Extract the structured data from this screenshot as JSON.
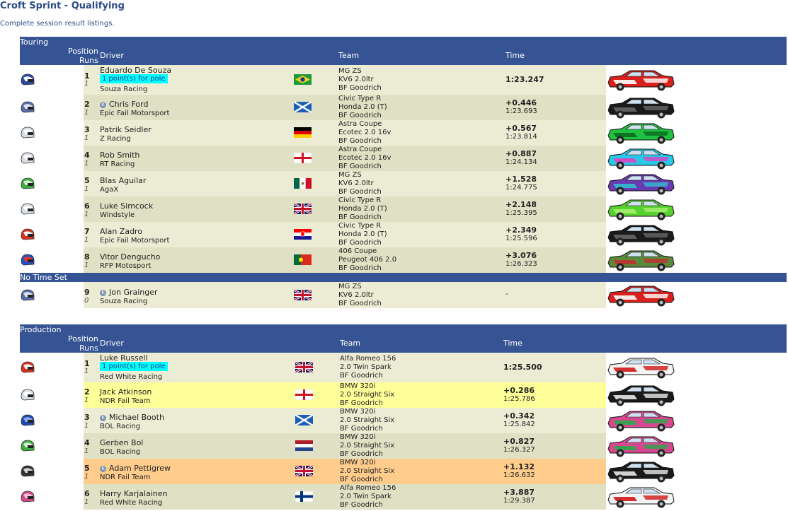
{
  "page": {
    "title": "Croft Sprint - Qualifying",
    "subtitle": "Complete session result listings."
  },
  "headers": {
    "position": "Position",
    "runs": "Runs",
    "driver": "Driver",
    "team": "Team",
    "time": "Time"
  },
  "touring": {
    "class_name": "Touring",
    "no_time_label": "No Time Set",
    "rows": [
      {
        "pos": "1",
        "runs": "1",
        "driver": "Eduardo De Souza",
        "badge": "1 point(s) for pole",
        "team": "Souza Racing",
        "car": [
          "MG ZS",
          "KV6 2.0ltr",
          "BF Goodrich"
        ],
        "time": "1:23.247",
        "lap": "",
        "flag": "brazil",
        "helmet": "helmet-blue-white",
        "livery": "red-white"
      },
      {
        "pos": "2",
        "runs": "1",
        "driver": "Chris Ford",
        "k": true,
        "team": "Epic Fail Motorsport",
        "car": [
          "Civic Type R",
          "Honda 2.0 (T)",
          "BF Goodrich"
        ],
        "time": "+0.446",
        "lap": "1:23.693",
        "flag": "scotland",
        "helmet": "helmet-blue-silver",
        "livery": "black"
      },
      {
        "pos": "3",
        "runs": "1",
        "driver": "Patrik Seidler",
        "team": "Z Racing",
        "car": [
          "Astra Coupe",
          "Ecotec 2.0 16v",
          "BF Goodrich"
        ],
        "time": "+0.567",
        "lap": "1:23.814",
        "flag": "germany",
        "helmet": "helmet-white",
        "livery": "green"
      },
      {
        "pos": "4",
        "runs": "1",
        "driver": "Rob Smith",
        "team": "RT Racing",
        "car": [
          "Astra Coupe",
          "Ecotec 2.0 16v",
          "BF Goodrich"
        ],
        "time": "+0.887",
        "lap": "1:24.134",
        "flag": "england",
        "helmet": "helmet-white",
        "livery": "cyan-pink"
      },
      {
        "pos": "5",
        "runs": "1",
        "driver": "Blas Aguilar",
        "team": "AgaX",
        "car": [
          "MG ZS",
          "KV6 2.0ltr",
          "BF Goodrich"
        ],
        "time": "+1.528",
        "lap": "1:24.775",
        "flag": "mexico",
        "helmet": "helmet-green",
        "livery": "purple"
      },
      {
        "pos": "6",
        "runs": "1",
        "driver": "Luke Simcock",
        "team": "Windstyle",
        "car": [
          "Civic Type R",
          "Honda 2.0 (T)",
          "BF Goodrich"
        ],
        "time": "+2.148",
        "lap": "1:25.395",
        "flag": "uk",
        "helmet": "helmet-white",
        "livery": "lime"
      },
      {
        "pos": "7",
        "runs": "1",
        "driver": "Alan Zadro",
        "team": "Epic Fail Motorsport",
        "car": [
          "Civic Type R",
          "Honda 2.0 (T)",
          "BF Goodrich"
        ],
        "time": "+2.349",
        "lap": "1:25.596",
        "flag": "croatia",
        "helmet": "helmet-red-white",
        "livery": "black"
      },
      {
        "pos": "8",
        "runs": "1",
        "driver": "Vitor Dengucho",
        "team": "RFP Motosport",
        "car": [
          "406 Coupe",
          "Peugeot 406 2.0",
          "BF Goodrich"
        ],
        "time": "+3.076",
        "lap": "1:26.323",
        "flag": "portugal",
        "helmet": "helmet-blue-red",
        "livery": "olive"
      }
    ],
    "no_time_rows": [
      {
        "pos": "9",
        "runs": "0",
        "driver": "Jon Grainger",
        "k": true,
        "team": "Souza Racing",
        "car": [
          "MG ZS",
          "KV6 2.0ltr",
          "BF Goodrich"
        ],
        "time": "-",
        "lap": "",
        "flag": "uk",
        "helmet": "helmet-blue-silver",
        "livery": "red-white"
      }
    ]
  },
  "production": {
    "class_name": "Production",
    "rows": [
      {
        "pos": "1",
        "runs": "1",
        "driver": "Luke Russell",
        "badge": "1 point(s) for pole",
        "team": "Red White Racing",
        "car": [
          "Alfa Romeo 156",
          "2.0 Twin Spark",
          "BF Goodrich"
        ],
        "time": "1:25.500",
        "lap": "",
        "flag": "uk",
        "helmet": "helmet-red-white",
        "livery": "white-red"
      },
      {
        "pos": "2",
        "runs": "1",
        "driver": "Jack Atkinson",
        "team": "NDR Fail Team",
        "car": [
          "BMW 320i",
          "2.0 Straight Six",
          "BF Goodrich"
        ],
        "time": "+0.286",
        "lap": "1:25.786",
        "flag": "england",
        "helmet": "helmet-white",
        "livery": "black-coke",
        "hl": "yellow"
      },
      {
        "pos": "3",
        "runs": "1",
        "driver": "Michael Booth",
        "k": true,
        "team": "BOL Racing",
        "car": [
          "BMW 320i",
          "2.0 Straight Six",
          "BF Goodrich"
        ],
        "time": "+0.342",
        "lap": "1:25.842",
        "flag": "scotland",
        "helmet": "helmet-blue",
        "livery": "pink-green"
      },
      {
        "pos": "4",
        "runs": "1",
        "driver": "Gerben Bol",
        "team": "BOL Racing",
        "car": [
          "BMW 320i",
          "2.0 Straight Six",
          "BF Goodrich"
        ],
        "time": "+0.827",
        "lap": "1:26.327",
        "flag": "netherlands",
        "helmet": "helmet-green",
        "livery": "pink-green"
      },
      {
        "pos": "5",
        "runs": "1",
        "driver": "Adam Pettigrew",
        "k": true,
        "team": "NDR Fail Team",
        "car": [
          "BMW 320i",
          "2.0 Straight Six",
          "BF Goodrich"
        ],
        "time": "+1.132",
        "lap": "1:26.632",
        "flag": "uk",
        "helmet": "helmet-black-silver",
        "livery": "black-coke",
        "hl": "orange"
      },
      {
        "pos": "6",
        "runs": "1",
        "driver": "Harry Karjalainen",
        "team": "Red White Racing",
        "car": [
          "Alfa Romeo 156",
          "2.0 Twin Spark",
          "BF Goodrich"
        ],
        "time": "+3.887",
        "lap": "1:29.387",
        "flag": "finland",
        "helmet": "helmet-pink",
        "livery": "white-red"
      }
    ]
  },
  "colors": {
    "header": "#365494",
    "row_light": "#ececd4",
    "row_dark": "#e0e0c4",
    "highlight_yellow": "#ffff99",
    "highlight_orange": "#ffcc8c",
    "pole_badge": "#00ffff"
  }
}
